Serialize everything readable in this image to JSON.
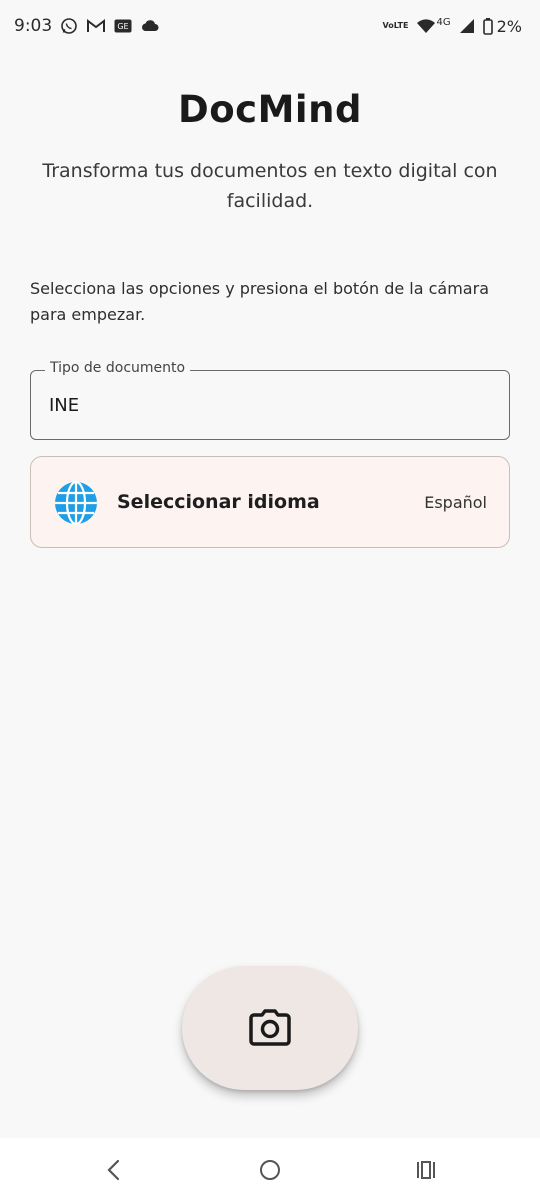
{
  "status_bar": {
    "time": "9:03",
    "left_icons": [
      "whatsapp-icon",
      "gmail-icon",
      "ge-badge-icon",
      "cloud-icon"
    ],
    "ge_badge_text": "GE",
    "volte_text_top": "Vo",
    "volte_text_bottom": "LTE",
    "network_label": "4G",
    "battery_text": "2%"
  },
  "header": {
    "title": "DocMind",
    "subtitle": "Transforma tus documentos en texto digital con facilidad."
  },
  "instructions": "Selecciona las opciones y presiona el botón de la cámara para empezar.",
  "document_type_field": {
    "label": "Tipo de documento",
    "value": "INE"
  },
  "language_selector": {
    "label": "Seleccionar idioma",
    "value": "Español",
    "icon": "globe-icon"
  },
  "camera_button": {
    "icon": "camera-icon",
    "background": "#efe7e3"
  },
  "nav_bar": {
    "items": [
      "back-icon",
      "home-icon",
      "recents-icon"
    ]
  },
  "colors": {
    "background": "#f8f8f8",
    "card_background": "#fdf4f2",
    "globe_blue": "#1e9ee6"
  }
}
